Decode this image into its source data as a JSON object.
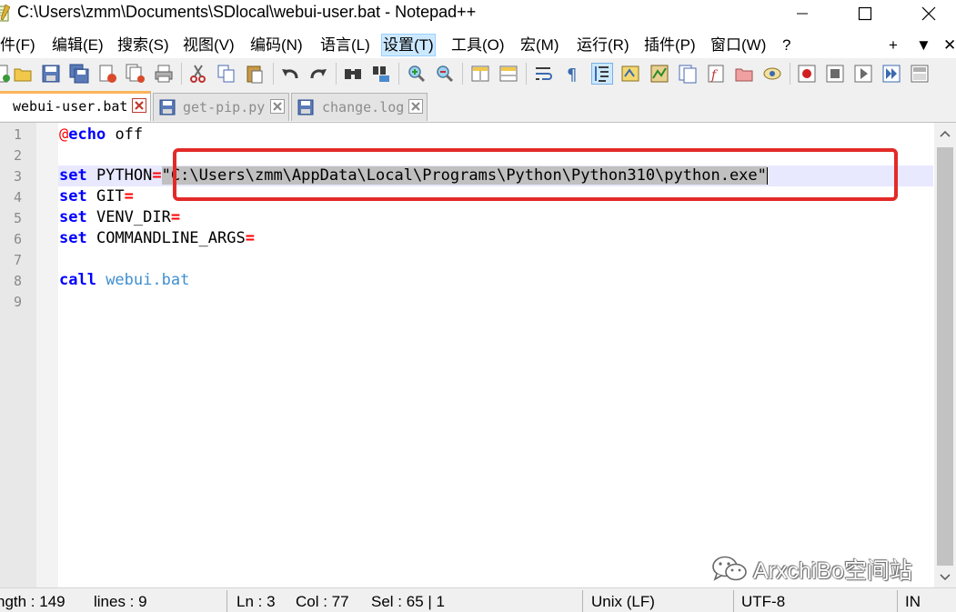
{
  "window": {
    "title": "C:\\Users\\zmm\\Documents\\SDlocal\\webui-user.bat - Notepad++",
    "controls": {
      "minimize": "minimize-icon",
      "maximize": "maximize-icon",
      "close": "close-icon"
    }
  },
  "menu": {
    "items": [
      "文件(F)",
      "编辑(E)",
      "搜索(S)",
      "视图(V)",
      "编码(N)",
      "语言(L)",
      "设置(T)",
      "工具(O)",
      "宏(M)",
      "运行(R)",
      "插件(P)",
      "窗口(W)",
      "?"
    ],
    "right": [
      "+",
      "▼",
      "✕"
    ]
  },
  "tabs": [
    {
      "label": "webui-user.bat",
      "active": true
    },
    {
      "label": "get-pip.py",
      "active": false
    },
    {
      "label": "change.log",
      "active": false
    }
  ],
  "editor": {
    "line_numbers": [
      "1",
      "2",
      "3",
      "4",
      "5",
      "6",
      "7",
      "8",
      "9"
    ],
    "current_line": 3,
    "lines": {
      "l1_at": "@",
      "l1_kw": "echo",
      "l1_rest": " off",
      "l3_kw": "set",
      "l3_var": " PYTHON",
      "l3_op": "=",
      "l3_value": "\"C:\\Users\\zmm\\AppData\\Local\\Programs\\Python\\Python310\\python.exe\"",
      "l4_kw": "set",
      "l4_var": " GIT",
      "l4_op": "=",
      "l5_kw": "set",
      "l5_var": " VENV_DIR",
      "l5_op": "=",
      "l6_kw": "set",
      "l6_var": " COMMANDLINE_ARGS",
      "l6_op": "=",
      "l8_kw": "call",
      "l8_label": " webui.bat"
    }
  },
  "watermark": {
    "text": "ArxchiBo空间站"
  },
  "status": {
    "length": "ngth : 149",
    "lines": "lines : 9",
    "ln": "Ln : 3",
    "col": "Col : 77",
    "sel": "Sel : 65 | 1",
    "eol": "Unix (LF)",
    "encoding": "UTF-8",
    "mode": "IN"
  },
  "colors": {
    "keyword": "#0000ff",
    "operator": "#ff0000",
    "label": "#3f8fd0",
    "selection": "#c0c0c0",
    "highlight_box": "#e22a28",
    "active_tab_accent": "#fab45a"
  }
}
